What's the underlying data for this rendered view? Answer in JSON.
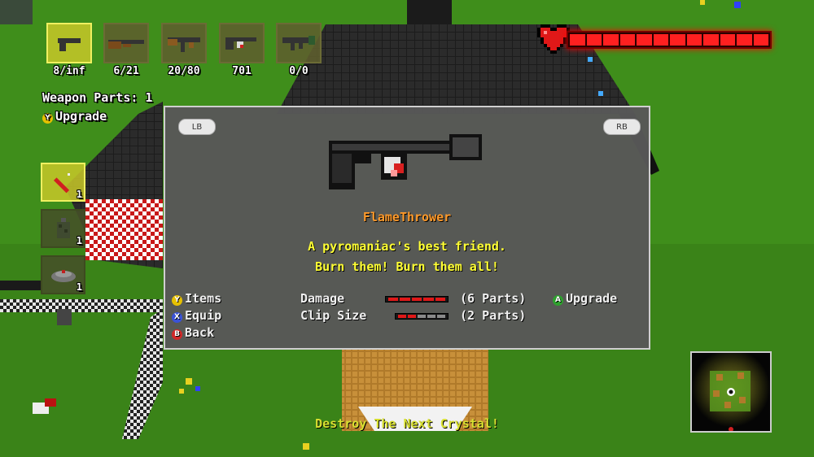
{
  "weapons": [
    {
      "name": "pistol",
      "count": "8/inf",
      "selected": true
    },
    {
      "name": "shotgun",
      "count": "6/21",
      "selected": false
    },
    {
      "name": "machine-gun",
      "count": "20/80",
      "selected": false
    },
    {
      "name": "flamethrower",
      "count": "701",
      "selected": false
    },
    {
      "name": "rocket-launcher",
      "count": "0/0",
      "selected": false
    }
  ],
  "weapon_parts_label": "Weapon Parts: 1",
  "upgrade_hint": {
    "button": "Y",
    "label": "Upgrade"
  },
  "items": [
    {
      "name": "dynamite",
      "count": "1",
      "selected": true
    },
    {
      "name": "grenade",
      "count": "1",
      "selected": false
    },
    {
      "name": "landmine",
      "count": "1",
      "selected": false
    }
  ],
  "health": {
    "level": 1.0,
    "color": "#ff2020"
  },
  "dialog": {
    "left_shoulder": "LB",
    "right_shoulder": "RB",
    "weapon_name": "FlameThrower",
    "description": [
      "A pyromaniac's best friend.",
      "Burn them! Burn them all!"
    ],
    "controls": [
      {
        "button": "Y",
        "label": "Items"
      },
      {
        "button": "X",
        "label": "Equip"
      },
      {
        "button": "B",
        "label": "Back"
      }
    ],
    "stats": [
      {
        "label": "Damage",
        "parts": "(6 Parts)",
        "filled": 5,
        "total": 5
      },
      {
        "label": "Clip Size",
        "parts": "(2 Parts)",
        "filled": 2,
        "total": 5
      }
    ],
    "upgrade": {
      "button": "A",
      "label": "Upgrade"
    }
  },
  "objective": "Destroy The Next Crystal!",
  "colors": {
    "accent_orange": "#ff9a2a",
    "text_yellow": "#ffff33",
    "health_red": "#ff2020"
  }
}
